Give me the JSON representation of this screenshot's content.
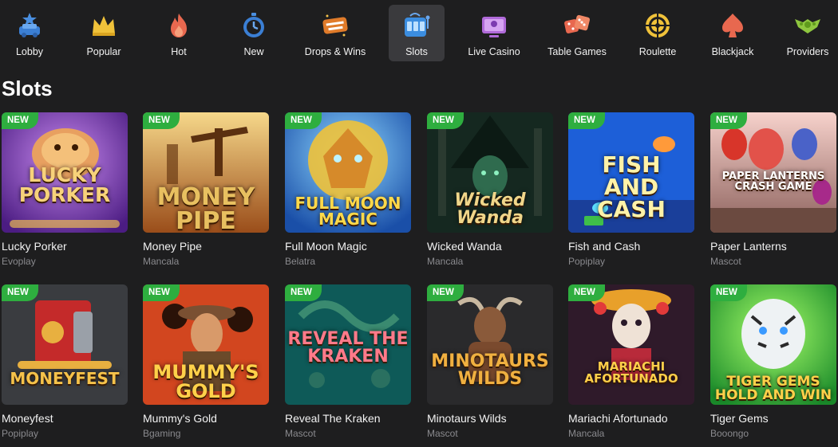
{
  "nav": {
    "items": [
      {
        "label": "Lobby",
        "icon": "lobby-car-star-icon"
      },
      {
        "label": "Popular",
        "icon": "crown-icon"
      },
      {
        "label": "Hot",
        "icon": "flame-icon"
      },
      {
        "label": "New",
        "icon": "stopwatch-icon"
      },
      {
        "label": "Drops & Wins",
        "icon": "drops-wins-logo-icon"
      },
      {
        "label": "Slots",
        "icon": "slot-machine-icon",
        "active": true
      },
      {
        "label": "Live Casino",
        "icon": "live-dealer-icon"
      },
      {
        "label": "Table Games",
        "icon": "dice-icon"
      },
      {
        "label": "Roulette",
        "icon": "roulette-wheel-icon"
      },
      {
        "label": "Blackjack",
        "icon": "spade-card-icon"
      },
      {
        "label": "Providers",
        "icon": "providers-wings-icon"
      }
    ]
  },
  "section": {
    "title": "Slots"
  },
  "badge_text": "NEW",
  "games": [
    {
      "title": "Lucky Porker",
      "provider": "Evoplay",
      "art": "LUCKY\nPORKER"
    },
    {
      "title": "Money Pipe",
      "provider": "Mancala",
      "art": "MONEY\nPIPE"
    },
    {
      "title": "Full Moon Magic",
      "provider": "Belatra",
      "art": "FULL MOON\nMAGIC"
    },
    {
      "title": "Wicked Wanda",
      "provider": "Mancala",
      "art": "Wicked Wanda"
    },
    {
      "title": "Fish and Cash",
      "provider": "Popiplay",
      "art": "FISH\nAND\nCASH"
    },
    {
      "title": "Paper Lanterns",
      "provider": "Mascot",
      "art": "PAPER LANTERNS\nCRASH GAME"
    },
    {
      "title": "Moneyfest",
      "provider": "Popiplay",
      "art": "MONEYFEST"
    },
    {
      "title": "Mummy's Gold",
      "provider": "Bgaming",
      "art": "MUMMY'S\nGOLD"
    },
    {
      "title": "Reveal The Kraken",
      "provider": "Mascot",
      "art": "REVEAL THE\nKRAKEN"
    },
    {
      "title": "Minotaurs Wilds",
      "provider": "Mascot",
      "art": "MINOTAURS\nWILDS"
    },
    {
      "title": "Mariachi Afortunado",
      "provider": "Mancala",
      "art": "MARIACHI\nAFORTUNADO"
    },
    {
      "title": "Tiger Gems",
      "provider": "Booongo",
      "art": "TIGER GEMS\nHOLD AND WIN"
    }
  ],
  "colors": {
    "background": "#1e1e1f",
    "active_nav": "#3a3a3d",
    "badge": "#2eae3f",
    "provider_text": "#8a8a8e"
  }
}
